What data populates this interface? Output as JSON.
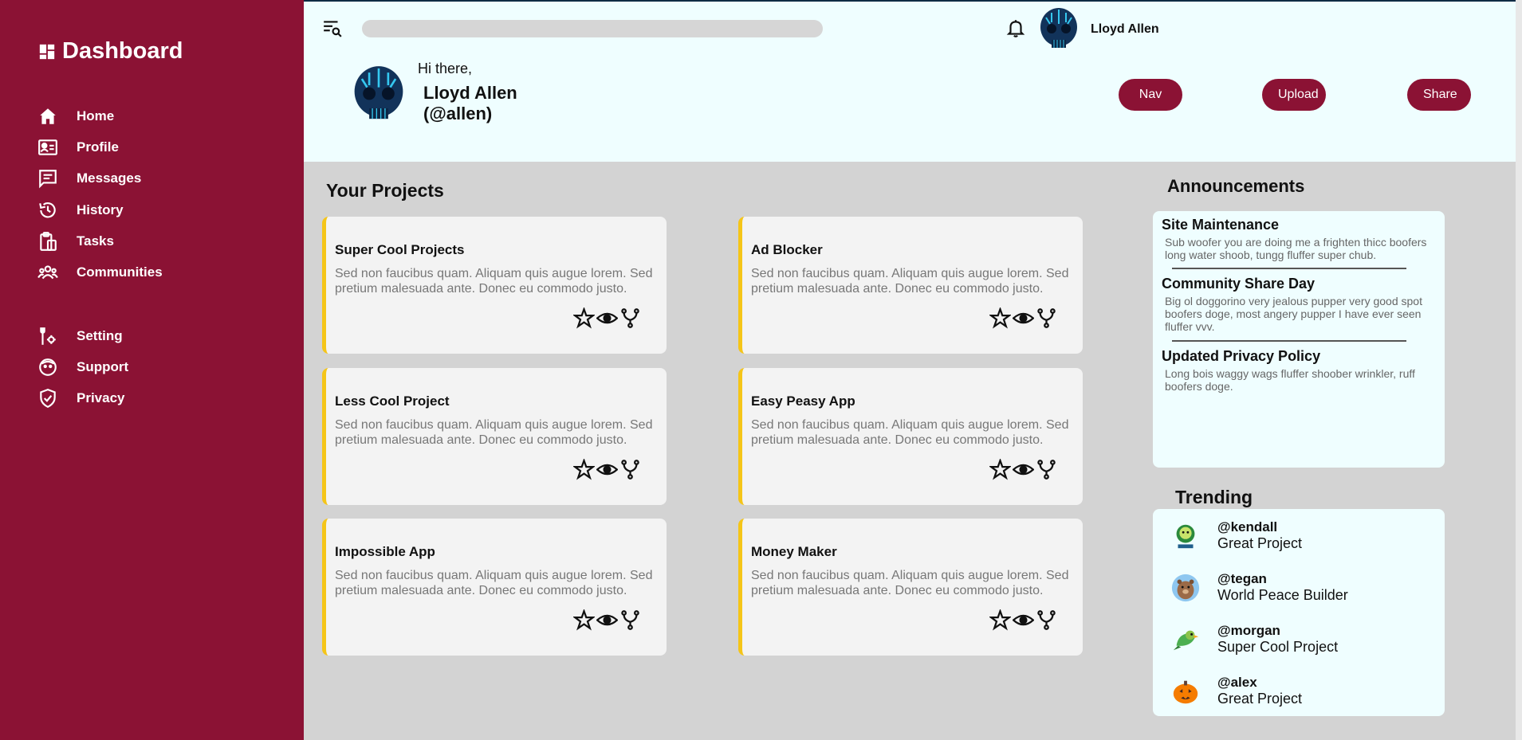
{
  "brand": {
    "title": "Dashboard",
    "icon": "dashboard-icon"
  },
  "sidebar": {
    "items": [
      {
        "label": "Home",
        "icon": "home-icon"
      },
      {
        "label": "Profile",
        "icon": "id-card-icon"
      },
      {
        "label": "Messages",
        "icon": "message-icon"
      },
      {
        "label": "History",
        "icon": "history-icon"
      },
      {
        "label": "Tasks",
        "icon": "clipboard-icon"
      },
      {
        "label": "Communities",
        "icon": "people-icon"
      }
    ],
    "secondary": [
      {
        "label": "Setting",
        "icon": "settings-icon"
      },
      {
        "label": "Support",
        "icon": "support-icon"
      },
      {
        "label": "Privacy",
        "icon": "shield-icon"
      }
    ]
  },
  "header": {
    "search_placeholder": "",
    "user_name": "Lloyd Allen",
    "greeting": "Hi there,",
    "full_name": "Lloyd Allen (@allen)",
    "buttons": {
      "nav": "Nav",
      "upload": "Upload",
      "share": "Share"
    }
  },
  "projects": {
    "title": "Your Projects",
    "items": [
      {
        "name": "Super Cool Projects",
        "desc": "Sed non faucibus quam. Aliquam quis augue lorem. Sed pretium malesuada ante. Donec eu commodo justo."
      },
      {
        "name": "Ad Blocker",
        "desc": "Sed non faucibus quam. Aliquam quis augue lorem. Sed pretium malesuada ante. Donec eu commodo justo."
      },
      {
        "name": "Less Cool Project",
        "desc": "Sed non faucibus quam. Aliquam quis augue lorem. Sed pretium malesuada ante. Donec eu commodo justo."
      },
      {
        "name": "Easy Peasy App",
        "desc": "Sed non faucibus quam. Aliquam quis augue lorem. Sed pretium malesuada ante. Donec eu commodo justo."
      },
      {
        "name": "Impossible App",
        "desc": "Sed non faucibus quam. Aliquam quis augue lorem. Sed pretium malesuada ante. Donec eu commodo justo."
      },
      {
        "name": "Money Maker",
        "desc": "Sed non faucibus quam. Aliquam quis augue lorem. Sed pretium malesuada ante. Donec eu commodo justo."
      }
    ]
  },
  "announcements": {
    "title": "Announcements",
    "items": [
      {
        "title": "Site Maintenance",
        "body": "Sub woofer you are doing me a frighten thicc boofers long water shoob, tungg fluffer super chub."
      },
      {
        "title": "Community Share Day",
        "body": "Big ol doggorino very jealous pupper very good spot boofers doge, most angery pupper I have ever seen fluffer vvv."
      },
      {
        "title": "Updated Privacy Policy",
        "body": "Long bois waggy wags fluffer shoober wrinkler, ruff boofers doge."
      }
    ]
  },
  "trending": {
    "title": "Trending",
    "items": [
      {
        "handle": "@kendall",
        "project": "Great Project"
      },
      {
        "handle": "@tegan",
        "project": "World Peace Builder"
      },
      {
        "handle": "@morgan",
        "project": "Super Cool Project"
      },
      {
        "handle": "@alex",
        "project": "Great Project"
      }
    ]
  },
  "colors": {
    "sidebar": "#8b1234",
    "header": "#effeff",
    "accent_border": "#f5c518",
    "content_bg": "#d3d3d3"
  }
}
